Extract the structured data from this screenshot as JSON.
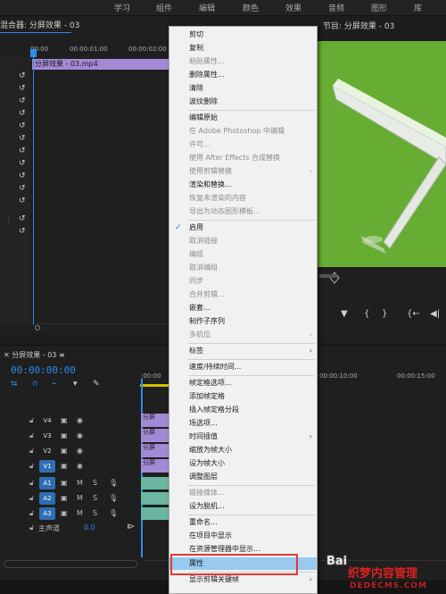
{
  "workspace_tabs": [
    "学习",
    "组件",
    "编辑",
    "颜色",
    "效果",
    "音频",
    "图形",
    "库"
  ],
  "effect_controls": {
    "title": "混合器: 分屏效果 - 03",
    "ruler": [
      "00:00",
      "00:00:01:00",
      "00:00:02:00"
    ],
    "clip_label": "分屏效果 - 03.mp4",
    "collapsed_dots": "⋮"
  },
  "program_monitor": {
    "title": "节目: 分屏效果 - 03",
    "menu_glyph": "≡"
  },
  "timeline": {
    "title": "分屏效果 - 03",
    "menu_glyph": "≡",
    "timecode": "00:00:00:00",
    "ruler": [
      ":00:00",
      "00:00:10:00",
      "00:00:15:00"
    ],
    "video_tracks": [
      "V4",
      "V3",
      "V2",
      "V1"
    ],
    "audio_tracks": [
      "A1",
      "A2",
      "A3"
    ],
    "master_label": "主声道",
    "master_value": "0.0",
    "clip_label_short": "分屏",
    "mute_label": "M",
    "solo_label": "S"
  },
  "context_menu": {
    "items": [
      {
        "label": "剪切",
        "disabled": false
      },
      {
        "label": "复制",
        "disabled": false
      },
      {
        "label": "粘贴属性...",
        "disabled": true
      },
      {
        "label": "删除属性...",
        "disabled": false
      },
      {
        "label": "清除",
        "disabled": false
      },
      {
        "label": "波纹删除",
        "disabled": false
      },
      {
        "label": "编辑原始",
        "disabled": false
      },
      {
        "label": "在 Adobe Photoshop 中编辑",
        "disabled": true
      },
      {
        "label": "许可...",
        "disabled": true
      },
      {
        "label": "使用 After Effects 合成替换",
        "disabled": true
      },
      {
        "label": "使用剪辑替换",
        "disabled": true,
        "submenu": true
      },
      {
        "label": "渲染和替换...",
        "disabled": false
      },
      {
        "label": "恢复未渲染的内容",
        "disabled": true
      },
      {
        "label": "导出为动态图形模板...",
        "disabled": true
      },
      {
        "label": "启用",
        "disabled": false,
        "checked": true
      },
      {
        "label": "取消链接",
        "disabled": true
      },
      {
        "label": "编组",
        "disabled": true
      },
      {
        "label": "取消编组",
        "disabled": true
      },
      {
        "label": "同步",
        "disabled": true
      },
      {
        "label": "合并剪辑...",
        "disabled": true
      },
      {
        "label": "嵌套...",
        "disabled": false
      },
      {
        "label": "制作子序列",
        "disabled": false
      },
      {
        "label": "多机位",
        "disabled": true,
        "submenu": true
      },
      {
        "label": "标签",
        "disabled": false,
        "submenu": true
      },
      {
        "label": "速度/持续时间...",
        "disabled": false
      },
      {
        "label": "帧定格选项...",
        "disabled": false
      },
      {
        "label": "添加帧定格",
        "disabled": false
      },
      {
        "label": "插入帧定格分段",
        "disabled": false
      },
      {
        "label": "场选项...",
        "disabled": false
      },
      {
        "label": "时间插值",
        "disabled": false,
        "submenu": true
      },
      {
        "label": "缩放为帧大小",
        "disabled": false
      },
      {
        "label": "设为帧大小",
        "disabled": false
      },
      {
        "label": "调整图层",
        "disabled": false
      },
      {
        "label": "链接媒体...",
        "disabled": true
      },
      {
        "label": "设为脱机...",
        "disabled": false
      },
      {
        "label": "重命名...",
        "disabled": false
      },
      {
        "label": "在项目中显示",
        "disabled": false
      },
      {
        "label": "在资源管理器中显示...",
        "disabled": false
      },
      {
        "label": "属性",
        "disabled": false,
        "highlighted": true
      },
      {
        "label": "显示剪辑关键帧",
        "disabled": false,
        "submenu": true
      }
    ]
  },
  "watermark": {
    "baidu": "Bai",
    "main": "织梦内容管理",
    "sub": "DEDECMS.COM"
  },
  "colors": {
    "accent_blue": "#2d8ceb",
    "clip_purple": "#a38ad6",
    "menu_highlight": "#99c9ef",
    "annotation_red": "#e03a3a",
    "monitor_green": "#67ad33"
  }
}
